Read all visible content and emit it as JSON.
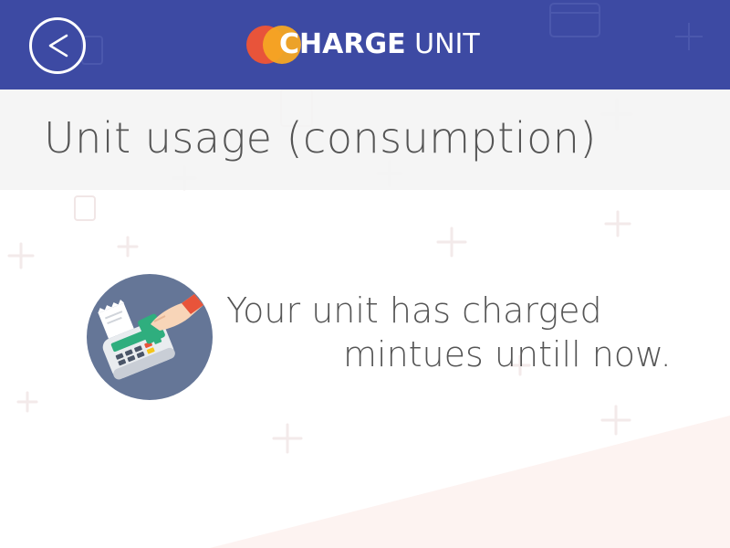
{
  "header": {
    "back_label": "<",
    "logo": {
      "bold_text": "CHARGE",
      "light_text": "UNIT",
      "colors": {
        "red": "#e8543a",
        "orange": "#f5a623"
      }
    },
    "background_color": "#3d4aa3"
  },
  "page": {
    "title": "Unit usage (consumption)"
  },
  "message": {
    "line1": "Your unit has charged",
    "line2": "mintues untill now."
  },
  "illustration": {
    "icon": "card-payment-terminal-icon",
    "circle_color": "#657697"
  }
}
